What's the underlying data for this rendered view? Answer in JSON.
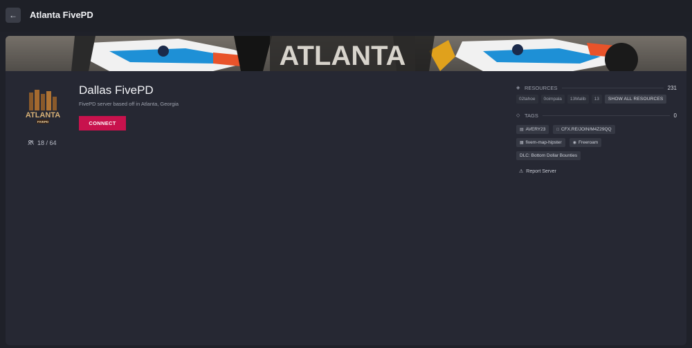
{
  "topbar": {
    "back_icon": "arrow-left-icon",
    "title": "Atlanta FivePD"
  },
  "banner": {
    "text": "ATLANTA",
    "accent_colors": [
      "#1e90d6",
      "#e8532a",
      "#ffffff"
    ]
  },
  "server": {
    "logo_text": "ATLANTA",
    "logo_sub": "FIVEPD",
    "players": "18 / 64",
    "title": "Dallas FivePD",
    "description": "FivePD server based off in Atlanta, Georgia",
    "connect_label": "CONNECT",
    "connect_color": "#c8124d"
  },
  "resources": {
    "label": "RESOURCES",
    "count": "231",
    "items": [
      "02tahoe",
      "0oimpala",
      "13Malib",
      "13"
    ],
    "show_all_label": "SHOW ALL RESOURCES"
  },
  "tags": {
    "label": "TAGS",
    "count": "0",
    "rows": [
      [
        {
          "icon": "server-icon",
          "text": "AVERY23"
        },
        {
          "icon": "link-icon",
          "text": "CFX.RE/JOIN/M4Z29QQ"
        }
      ],
      [
        {
          "icon": "map-icon",
          "text": "fivem-map-hipster"
        },
        {
          "icon": "car-icon",
          "text": "Freeroam"
        }
      ],
      [
        {
          "icon": "",
          "text": "DLC: Bottom Dollar Bounties"
        }
      ]
    ]
  },
  "report": {
    "icon": "warning-icon",
    "label": "Report Server"
  }
}
